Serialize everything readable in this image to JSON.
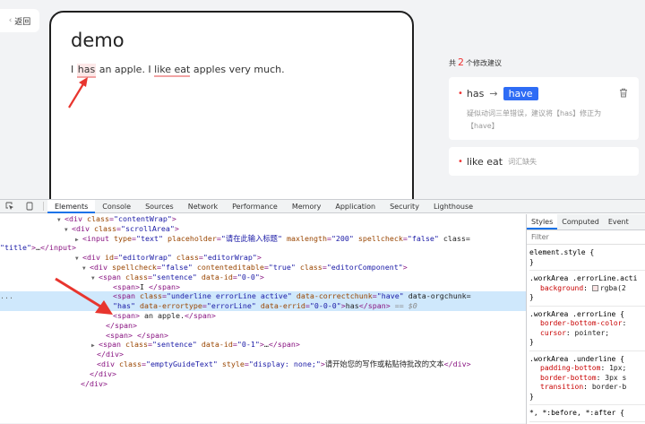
{
  "app": {
    "back_label": "返回",
    "editor_title": "demo",
    "sentence": {
      "p1": "I ",
      "w_have": "has",
      "p2": " an apple. I ",
      "w_like": "like eat",
      "p3": " apples very much."
    },
    "suggest_head": {
      "prefix": "共",
      "count": "2",
      "suffix": "个修改建议"
    },
    "suggestions": [
      {
        "wrong": "has",
        "arrow": "→",
        "right": "have",
        "desc": "疑似动词三单错误，建议将【has】修正为【have】"
      },
      {
        "wrong": "like eat",
        "tag": "词汇缺失"
      }
    ]
  },
  "devtools": {
    "tabs": [
      "Elements",
      "Console",
      "Sources",
      "Network",
      "Performance",
      "Memory",
      "Application",
      "Security",
      "Lighthouse"
    ],
    "active_tab": "Elements",
    "side_tabs": [
      "Styles",
      "Computed",
      "Event"
    ],
    "filter_placeholder": "Filter",
    "dom_lines": [
      {
        "tri": "▼",
        "indent": 72,
        "html": "<div class=\"contentWrap\">"
      },
      {
        "tri": "▼",
        "indent": 80,
        "html": "<div class=\"scrollArea\">"
      },
      {
        "tri": "▶",
        "indent": 92,
        "html": "<input type=\"text\" placeholder=\"请在此输入标题\" maxlength=\"200\" spellcheck=\"false\" class="
      },
      {
        "tri": "",
        "indent": 0,
        "html": "\"title\">…</input>"
      },
      {
        "tri": "▼",
        "indent": 92,
        "html": "<div id=\"editorWrap\" class=\"editorWrap\">"
      },
      {
        "tri": "▼",
        "indent": 100,
        "html": "<div spellcheck=\"false\" contenteditable=\"true\" class=\"editorComponent\">"
      },
      {
        "tri": "▼",
        "indent": 110,
        "html": "<span class=\"sentence\" data-id=\"0-0\">"
      },
      {
        "tri": "",
        "indent": 126,
        "html": "<span>I </span>"
      },
      {
        "tri": "",
        "indent": 126,
        "html": "<span class=\"underline errorLine active\" data-correctchunk=\"have\" data-orgchunk="
      },
      {
        "tri": "",
        "indent": 126,
        "html": "\"has\" data-errortype=\"errorLine\" data-errid=\"0-0-0\">has</span> == $0"
      },
      {
        "tri": "",
        "indent": 126,
        "html": "<span> an apple.</span>"
      },
      {
        "tri": "",
        "indent": 118,
        "html": "</span>"
      },
      {
        "tri": "",
        "indent": 118,
        "html": "<span> </span>"
      },
      {
        "tri": "▶",
        "indent": 110,
        "html": "<span class=\"sentence\" data-id=\"0-1\">…</span>"
      },
      {
        "tri": "",
        "indent": 108,
        "html": "</div>"
      },
      {
        "tri": "",
        "indent": 108,
        "html": "<div class=\"emptyGuideText\" style=\"display: none;\">请开始您的写作或粘贴待批改的文本</div>"
      },
      {
        "tri": "",
        "indent": 100,
        "html": "</div>"
      },
      {
        "tri": "",
        "indent": 90,
        "html": "</div>"
      }
    ],
    "styles": [
      {
        "sel": "element.style {",
        "props": [],
        "close": "}"
      },
      {
        "sel": ".workArea .errorLine.acti",
        "props": [
          {
            "p": "background",
            "v": "rgba(2"
          }
        ],
        "close": "}"
      },
      {
        "sel": ".workArea .errorLine {",
        "props": [
          {
            "p": "border-bottom-color",
            "v": ""
          },
          {
            "p": "cursor",
            "v": "pointer;"
          }
        ],
        "close": "}"
      },
      {
        "sel": ".workArea .underline {",
        "props": [
          {
            "p": "padding-bottom",
            "v": "1px;"
          },
          {
            "p": "border-bottom",
            "v": "3px s"
          },
          {
            "p": "transition",
            "v": "border-b"
          }
        ],
        "close": "}"
      },
      {
        "sel": "*, *:before, *:after {",
        "props": [],
        "close": ""
      }
    ]
  },
  "colors": {
    "accent": "#2e6cf5",
    "error": "#e33",
    "arrow": "#e8352e"
  }
}
